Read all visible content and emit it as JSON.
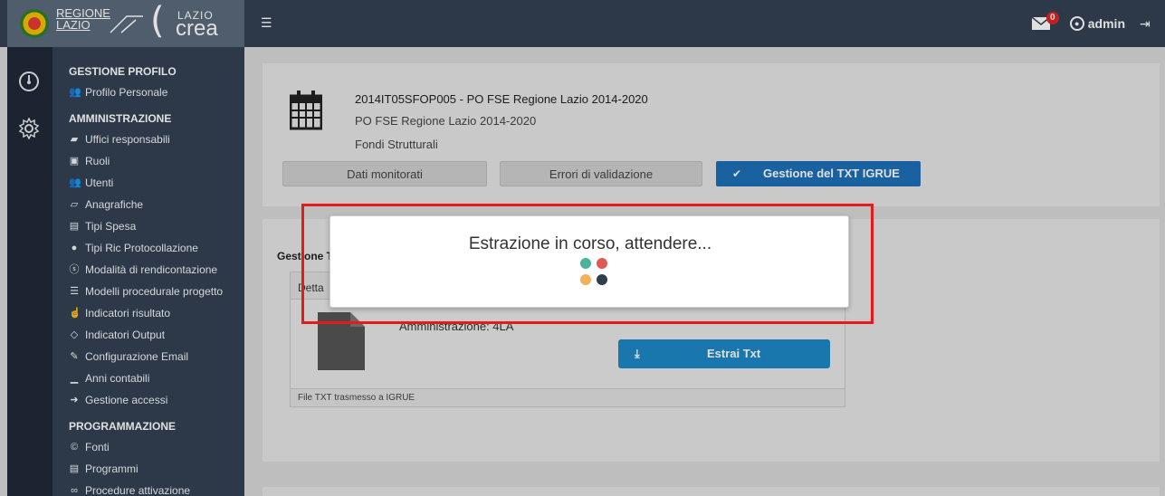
{
  "header": {
    "logo_regione_line1": "REGIONE",
    "logo_regione_line2": "LAZIO",
    "logo_crea_top": "LAZIO",
    "logo_crea_bottom": "crea",
    "mail_badge": "0",
    "user": "admin"
  },
  "sidebar": {
    "sections": [
      {
        "title": "GESTIONE PROFILO",
        "items": [
          {
            "label": "Profilo Personale",
            "icon": "users-icon"
          }
        ]
      },
      {
        "title": "AMMINISTRAZIONE",
        "items": [
          {
            "label": "Uffici responsabili",
            "icon": "briefcase-icon"
          },
          {
            "label": "Ruoli",
            "icon": "id-card-icon"
          },
          {
            "label": "Utenti",
            "icon": "users-icon"
          },
          {
            "label": "Anagrafiche",
            "icon": "book-icon"
          },
          {
            "label": "Tipi Spesa",
            "icon": "money-icon"
          },
          {
            "label": "Tipi Ric Protocollazione",
            "icon": "globe-icon"
          },
          {
            "label": "Modalità di rendicontazione",
            "icon": "dollar-circle-icon"
          },
          {
            "label": "Modelli procedurale progetto",
            "icon": "list-icon"
          },
          {
            "label": "Indicatori risultato",
            "icon": "hand-icon"
          },
          {
            "label": "Indicatori Output",
            "icon": "tag-icon"
          },
          {
            "label": "Configurazione Email",
            "icon": "wrench-icon"
          },
          {
            "label": "Anni contabili",
            "icon": "chart-icon"
          },
          {
            "label": "Gestione accessi",
            "icon": "sign-in-icon"
          }
        ]
      },
      {
        "title": "PROGRAMMAZIONE",
        "items": [
          {
            "label": "Fonti",
            "icon": "copyright-icon"
          },
          {
            "label": "Programmi",
            "icon": "money-icon"
          },
          {
            "label": "Procedure attivazione",
            "icon": "link-icon"
          }
        ]
      }
    ]
  },
  "program": {
    "title": "2014IT05SFOP005 - PO FSE Regione Lazio 2014-2020",
    "subtitle": "PO FSE Regione Lazio 2014-2020",
    "category": "Fondi Strutturali",
    "tabs": [
      "Dati monitorati",
      "Errori di validazione",
      "Gestione del TXT IGRUE"
    ],
    "active_tab": "Gestione del TXT IGRUE"
  },
  "gestione": {
    "heading": "Gestione T",
    "panel_head": "Detta",
    "administration": "Amministrazione: 4LA",
    "extract_button": "Estrai Txt",
    "footer": "File TXT trasmesso a IGRUE"
  },
  "modal": {
    "message": "Estrazione in corso, attendere...",
    "dot_colors": [
      "#4bb39b",
      "#e05a55",
      "#f0b35a",
      "#2f3e4c"
    ]
  },
  "highlight_color": "#e51b1b"
}
